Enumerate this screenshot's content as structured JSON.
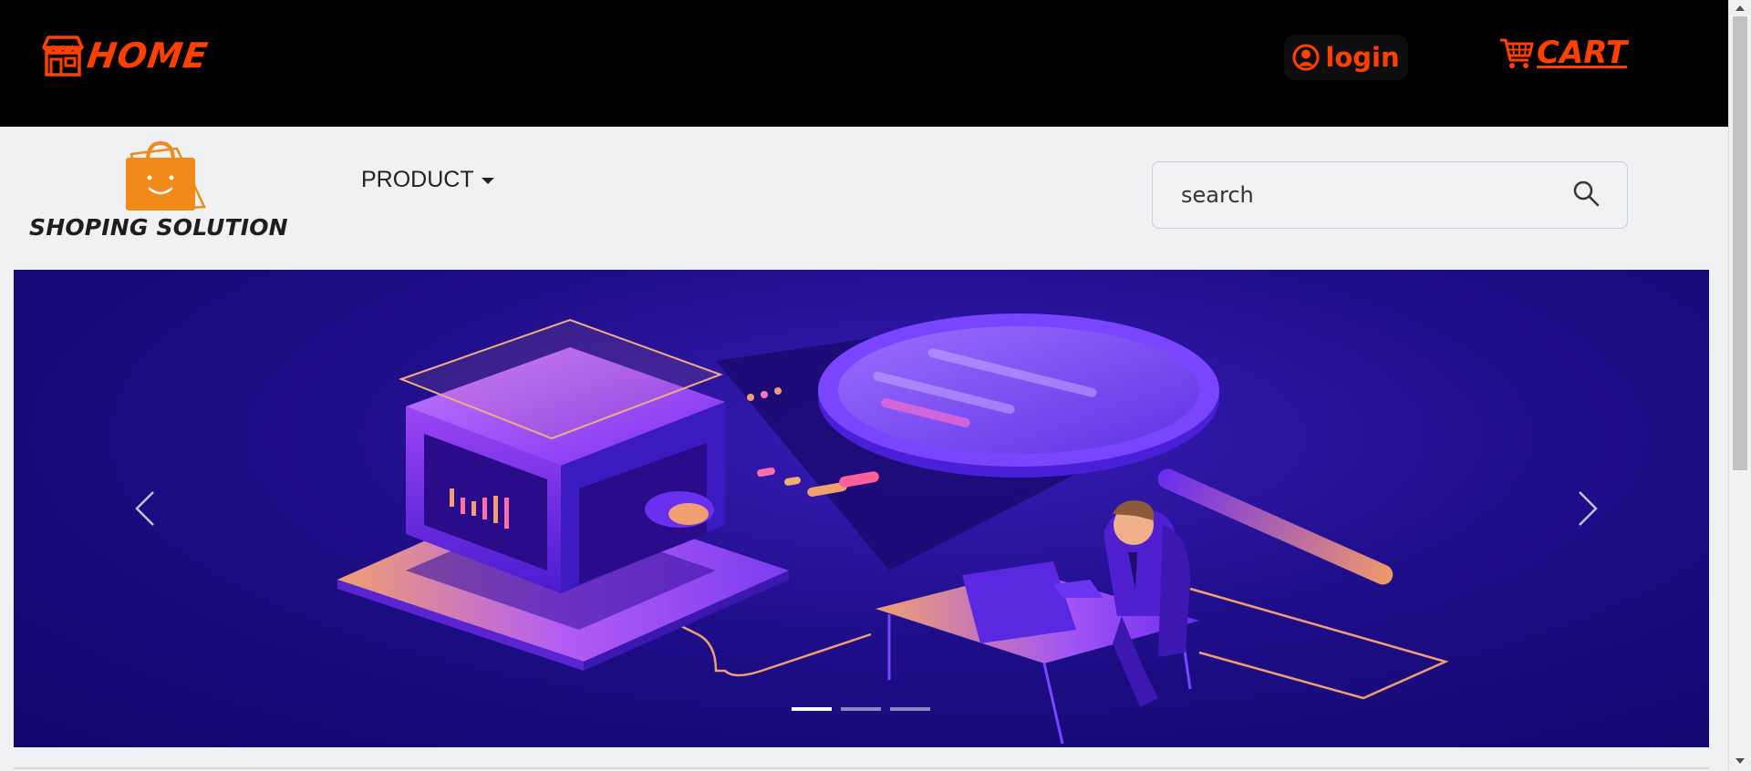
{
  "topbar": {
    "home_label": "HOME",
    "login_label": "login",
    "cart_label": "CART",
    "accent_color": "#ff4000",
    "icons": [
      "store-icon",
      "user-circle-icon",
      "cart-icon"
    ]
  },
  "navbar": {
    "brand": "SHOPING SOLUTION",
    "logo_icon": "shopping-bag-smile-icon",
    "product_menu_label": "PRODUCT",
    "search": {
      "placeholder": "search",
      "icon": "search-icon"
    }
  },
  "carousel": {
    "prev_icon": "chevron-left-icon",
    "next_icon": "chevron-right-icon",
    "slide_count": 3,
    "active_slide": 1
  }
}
